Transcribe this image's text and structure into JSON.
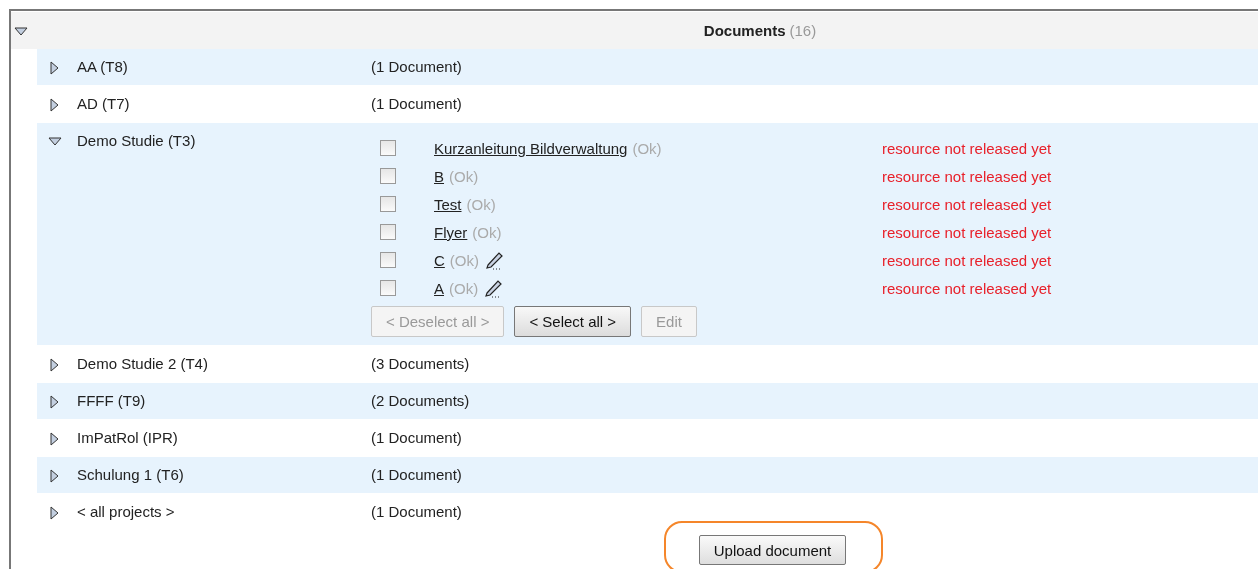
{
  "header": {
    "title": "Documents",
    "count": "(16)",
    "expanded": true
  },
  "projects": [
    {
      "name": "AA  (T8)",
      "count": "(1 Document)",
      "expanded": false
    },
    {
      "name": "AD  (T7)",
      "count": "(1 Document)",
      "expanded": false
    },
    {
      "name": "Demo Studie  (T3)",
      "expanded": true,
      "documents": [
        {
          "name": "Kurzanleitung Bildverwaltung",
          "status": "(Ok)",
          "editable": false,
          "checked": false,
          "note": "resource not released yet"
        },
        {
          "name": "B",
          "status": "(Ok)",
          "editable": false,
          "checked": false,
          "note": "resource not released yet"
        },
        {
          "name": "Test",
          "status": "(Ok)",
          "editable": false,
          "checked": false,
          "note": "resource not released yet"
        },
        {
          "name": "Flyer",
          "status": "(Ok)",
          "editable": false,
          "checked": false,
          "note": "resource not released yet"
        },
        {
          "name": "C",
          "status": "(Ok)",
          "editable": true,
          "checked": false,
          "note": "resource not released yet"
        },
        {
          "name": "A",
          "status": "(Ok)",
          "editable": true,
          "checked": false,
          "note": "resource not released yet"
        }
      ],
      "buttons": [
        {
          "label": "< Deselect all >",
          "disabled": true
        },
        {
          "label": "< Select all >",
          "disabled": false
        },
        {
          "label": "Edit",
          "disabled": true
        }
      ]
    },
    {
      "name": "Demo Studie 2  (T4)",
      "count": "(3 Documents)",
      "expanded": false
    },
    {
      "name": "FFFF  (T9)",
      "count": "(2 Documents)",
      "expanded": false
    },
    {
      "name": "ImPatRol  (IPR)",
      "count": "(1 Document)",
      "expanded": false
    },
    {
      "name": "Schulung 1  (T6)",
      "count": "(1 Document)",
      "expanded": false
    },
    {
      "name": "< all projects >",
      "count": "(1 Document)",
      "expanded": false
    }
  ],
  "upload_button": {
    "label": "Upload document",
    "highlighted": true
  }
}
